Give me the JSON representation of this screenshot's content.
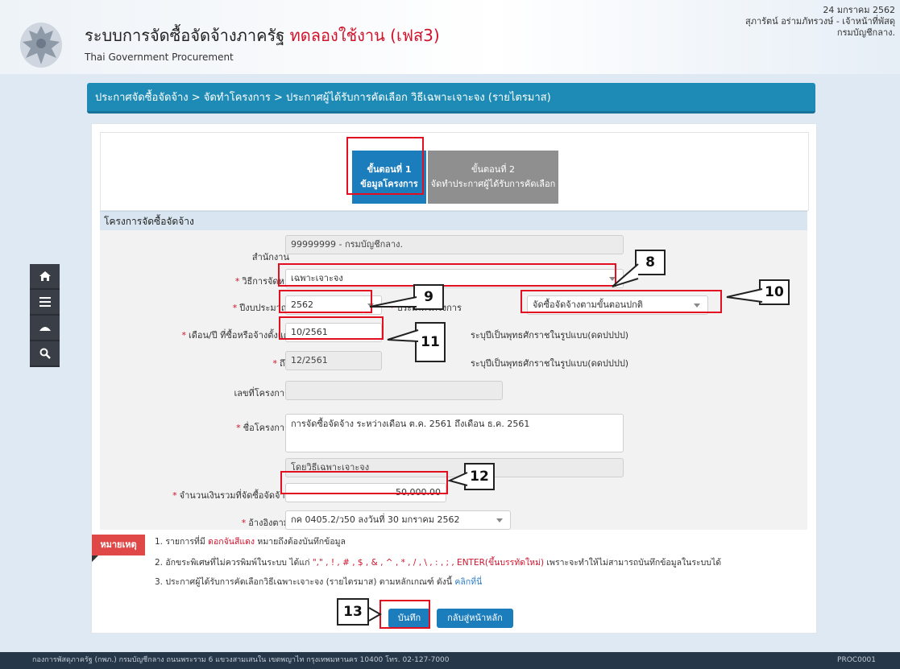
{
  "header": {
    "title": "ระบบการจัดซื้อจัดจ้างภาครัฐ",
    "mode": "ทดลองใช้งาน (เฟส3)",
    "subtitle": "Thai Government Procurement",
    "date": "24 มกราคม 2562",
    "user": "สุภารัตน์ อร่ามภัทรวงษ์ - เจ้าหน้าที่พัสดุ",
    "department": "กรมบัญชีกลาง."
  },
  "side_tools": [
    "home-icon",
    "menu-icon",
    "collapse-icon",
    "search-icon"
  ],
  "breadcrumb": "ประกาศจัดซื้อจัดจ้าง > จัดทำโครงการ > ประกาศผู้ได้รับการคัดเลือก วิธีเฉพาะเจาะจง (รายไตรมาส)",
  "steps": [
    {
      "line1": "ขั้นตอนที่ 1",
      "line2": "ข้อมูลโครงการ"
    },
    {
      "line1": "ขั้นตอนที่ 2",
      "line2": "จัดทำประกาศผู้ได้รับการคัดเลือก"
    }
  ],
  "section_title": "โครงการจัดซื้อจัดจ้าง",
  "form": {
    "agency_label": "สำนักงาน",
    "agency_value": "99999999 - กรมบัญชีกลาง.",
    "method_label": "วิธีการจัดหา",
    "method_value": "เฉพาะเจาะจง",
    "budget_year_label": "ปีงบประมาณ",
    "budget_year_value": "2562",
    "project_type_label": "ประเภทโครงการ",
    "project_type_value": "จัดซื้อจัดจ้างตามขั้นตอนปกติ",
    "from_label": "เดือน/ปี ที่ซื้อหรือจ้างตั้งแต่",
    "from_value": "10/2561",
    "from_hint": "ระบุปีเป็นพุทธศักราชในรูปแบบ(ดดปปปป)",
    "to_label": "ถึง",
    "to_value": "12/2561",
    "to_hint": "ระบุปีเป็นพุทธศักราชในรูปแบบ(ดดปปปป)",
    "project_no_label": "เลขที่โครงการ",
    "project_no_value": "",
    "project_name_label": "ชื่อโครงการ",
    "project_name_value": "การจัดซื้อจัดจ้าง ระหว่างเดือน ต.ค. 2561 ถึงเดือน ธ.ค. 2561",
    "project_name_suffix": "โดยวิธีเฉพาะเจาะจง",
    "amount_label": "จำนวนเงินรวมที่จัดซื้อจัดจ้าง",
    "amount_value": "50,000.00",
    "reference_label": "อ้างอิงตาม",
    "reference_value": "กค 0405.2/ว50 ลงวันที่ 30 มกราคม 2562"
  },
  "notes": {
    "tag": "หมายเหตุ",
    "line1_a": "1. รายการที่มี ",
    "line1_red": "ดอกจันสีแดง",
    "line1_b": " หมายถึงต้องบันทึกข้อมูล",
    "line2_a": "2. อักขระพิเศษที่ไม่ควรพิมพ์ในระบบ ได้แก่ ",
    "line2_red": "\",\" , ! , # , $ , & , ^ , * , / , \\ , : , ; , ENTER(ขึ้นบรรทัดใหม่)",
    "line2_b": " เพราะจะทำให้ไม่สามารถบันทึกข้อมูลในระบบได้",
    "line3_a": "3. ประกาศผู้ได้รับการคัดเลือกวิธีเฉพาะเจาะจง (รายไตรมาส) ตามหลักเกณฑ์ ดังนี้  ",
    "line3_link": "คลิกที่นี่"
  },
  "buttons": {
    "save": "บันทึก",
    "back": "กลับสู่หน้าหลัก"
  },
  "callouts": [
    "8",
    "9",
    "10",
    "11",
    "12",
    "13"
  ],
  "footer": {
    "address": "กองการพัสดุภาครัฐ (กพภ.) กรมบัญชีกลาง ถนนพระราม 6 แขวงสามเสนใน เขตพญาไท กรุงเทพมหานคร 10400 โทร. 02-127-7000",
    "code": "PROC0001"
  },
  "colors": {
    "primary": "#1c7dbd",
    "breadcrumb": "#1d8bb5",
    "required": "#d0132b",
    "highlight": "#e30e1f"
  }
}
